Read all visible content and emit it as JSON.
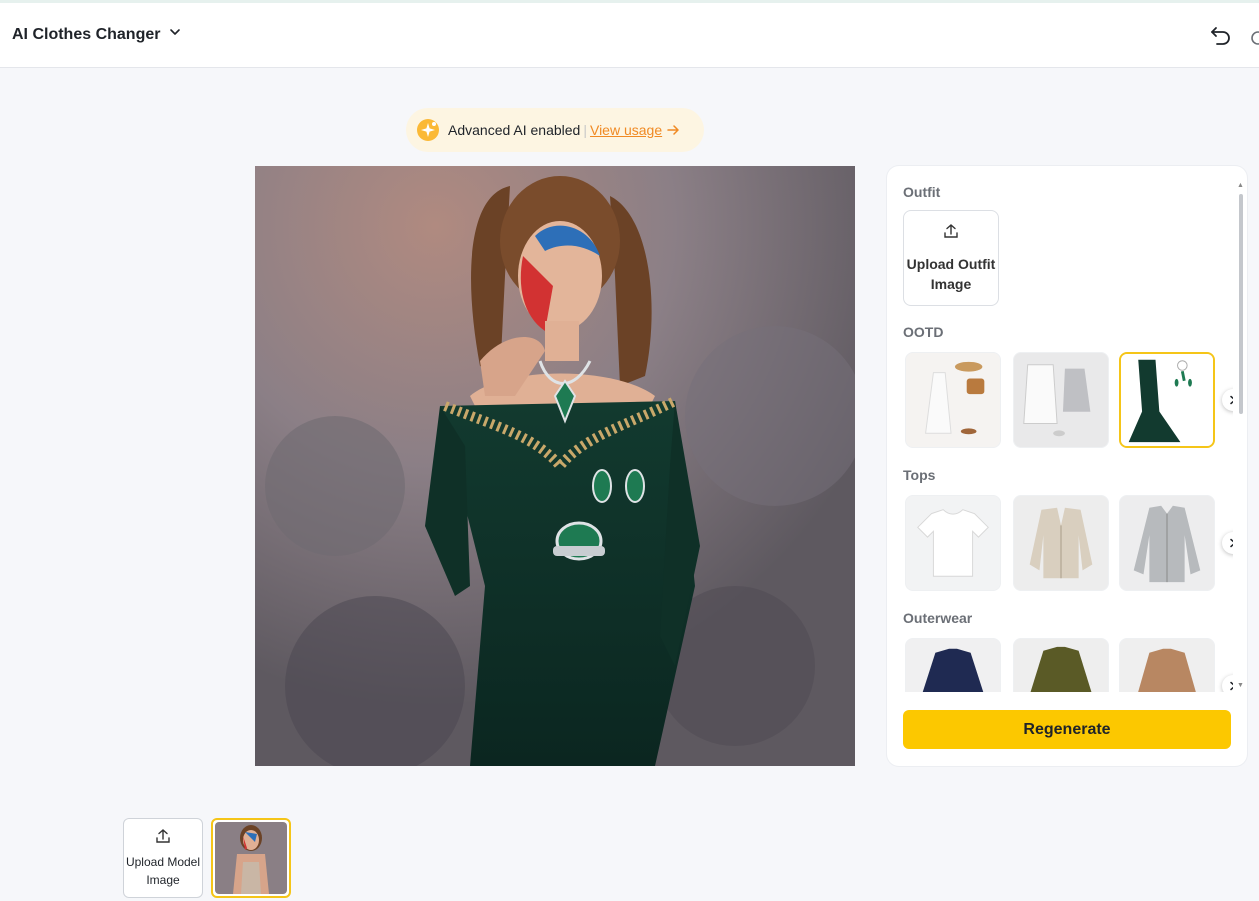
{
  "header": {
    "app_title": "AI Clothes Changer",
    "title_icon": "chevron-down-icon",
    "undo_icon": "undo-icon",
    "redo_icon": "redo-icon"
  },
  "ai_banner": {
    "text": "Advanced AI enabled",
    "separator": "|",
    "link": "View usage",
    "icon": "sparkle-icon",
    "link_color": "#f08a24"
  },
  "result_image": {
    "description_icon": "generated-result-image"
  },
  "panel": {
    "outfit_label": "Outfit",
    "upload_outfit": "Upload Outfit Image",
    "ootd_label": "OOTD",
    "ootd_items": [
      "white-dress-outfit",
      "white-coat-outfit",
      "green-velvet-gown-outfit"
    ],
    "ootd_selected_index": 2,
    "tops_label": "Tops",
    "tops_items": [
      "white-tshirt",
      "beige-cardigan",
      "grey-shirt"
    ],
    "outerwear_label": "Outerwear",
    "outerwear_items": [
      "navy-jacket",
      "olive-trench-coat",
      "tan-blazer"
    ],
    "regenerate": "Regenerate",
    "accent_color": "#fcc800"
  },
  "bottom": {
    "upload_model": "Upload Model Image"
  }
}
